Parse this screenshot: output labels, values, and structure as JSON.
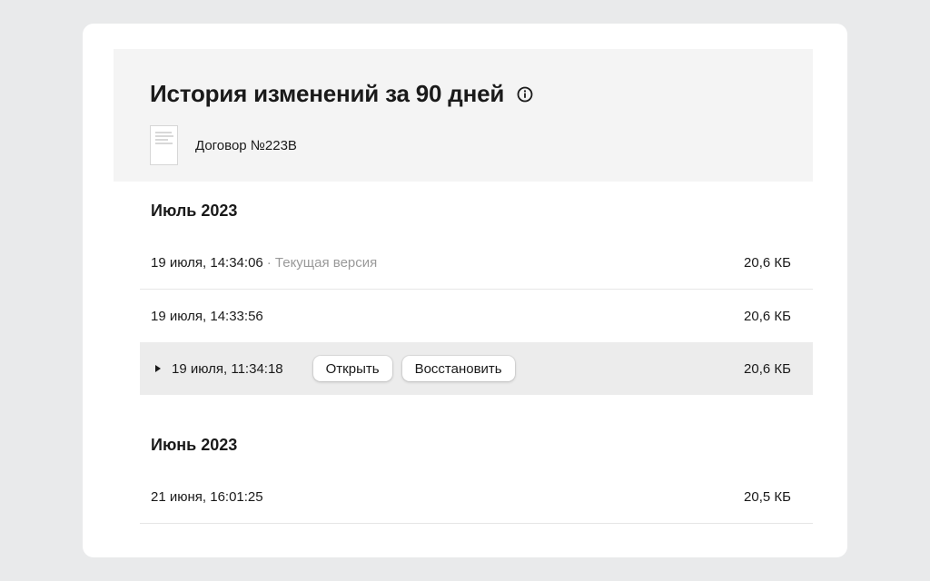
{
  "header": {
    "title": "История изменений за 90 дней",
    "info_icon": "info-circle-icon",
    "document_icon": "document-thumbnail-icon",
    "document_name": "Договор №223B"
  },
  "groups": [
    {
      "month": "Июль 2023",
      "versions": [
        {
          "time": "19 июля, 14:34:06",
          "current_label": "· Текущая версия",
          "size": "20,6 КБ"
        },
        {
          "time": "19 июля, 14:33:56",
          "size": "20,6 КБ"
        },
        {
          "time": "19 июля, 11:34:18",
          "size": "20,6 КБ",
          "selected": true,
          "open_label": "Открыть",
          "restore_label": "Восстановить"
        }
      ]
    },
    {
      "month": "Июнь 2023",
      "versions": [
        {
          "time": "21 июня, 16:01:25",
          "size": "20,5 КБ"
        }
      ]
    }
  ],
  "colors": {
    "page_bg": "#e9eaeb",
    "header_bg": "#f4f4f4",
    "selected_row_bg": "#ececec",
    "muted_text": "#999999"
  }
}
